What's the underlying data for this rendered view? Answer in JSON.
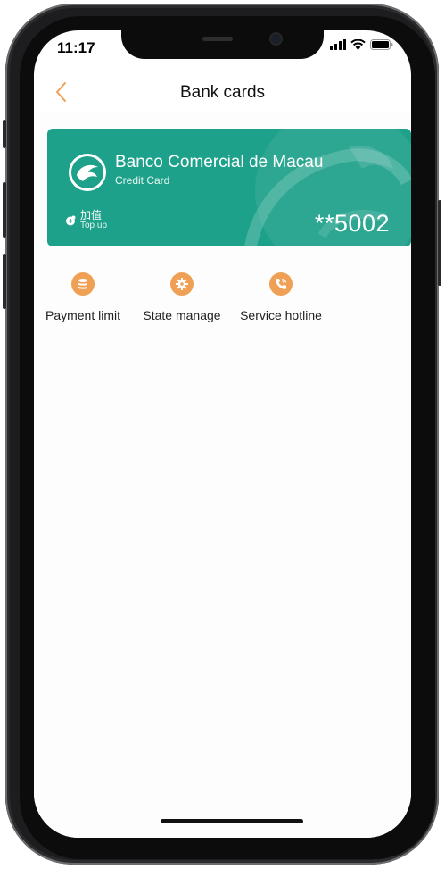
{
  "status_bar": {
    "time": "11:17",
    "icons": [
      "signal-icon",
      "wifi-icon",
      "battery-icon"
    ]
  },
  "nav": {
    "title": "Bank cards",
    "back_icon": "chevron-left-icon"
  },
  "card": {
    "bank_name": "Banco Comercial de Macau",
    "card_type": "Credit Card",
    "topup_cn": "加值",
    "topup_en": "Top up",
    "number": "**5002",
    "background_color": "#1ea18a"
  },
  "actions": [
    {
      "label": "Payment limit",
      "icon": "database-icon"
    },
    {
      "label": "State manage",
      "icon": "gear-icon"
    },
    {
      "label": "Service hotline",
      "icon": "phone-icon"
    }
  ],
  "colors": {
    "accent": "#f0a055",
    "card": "#1ea18a"
  }
}
